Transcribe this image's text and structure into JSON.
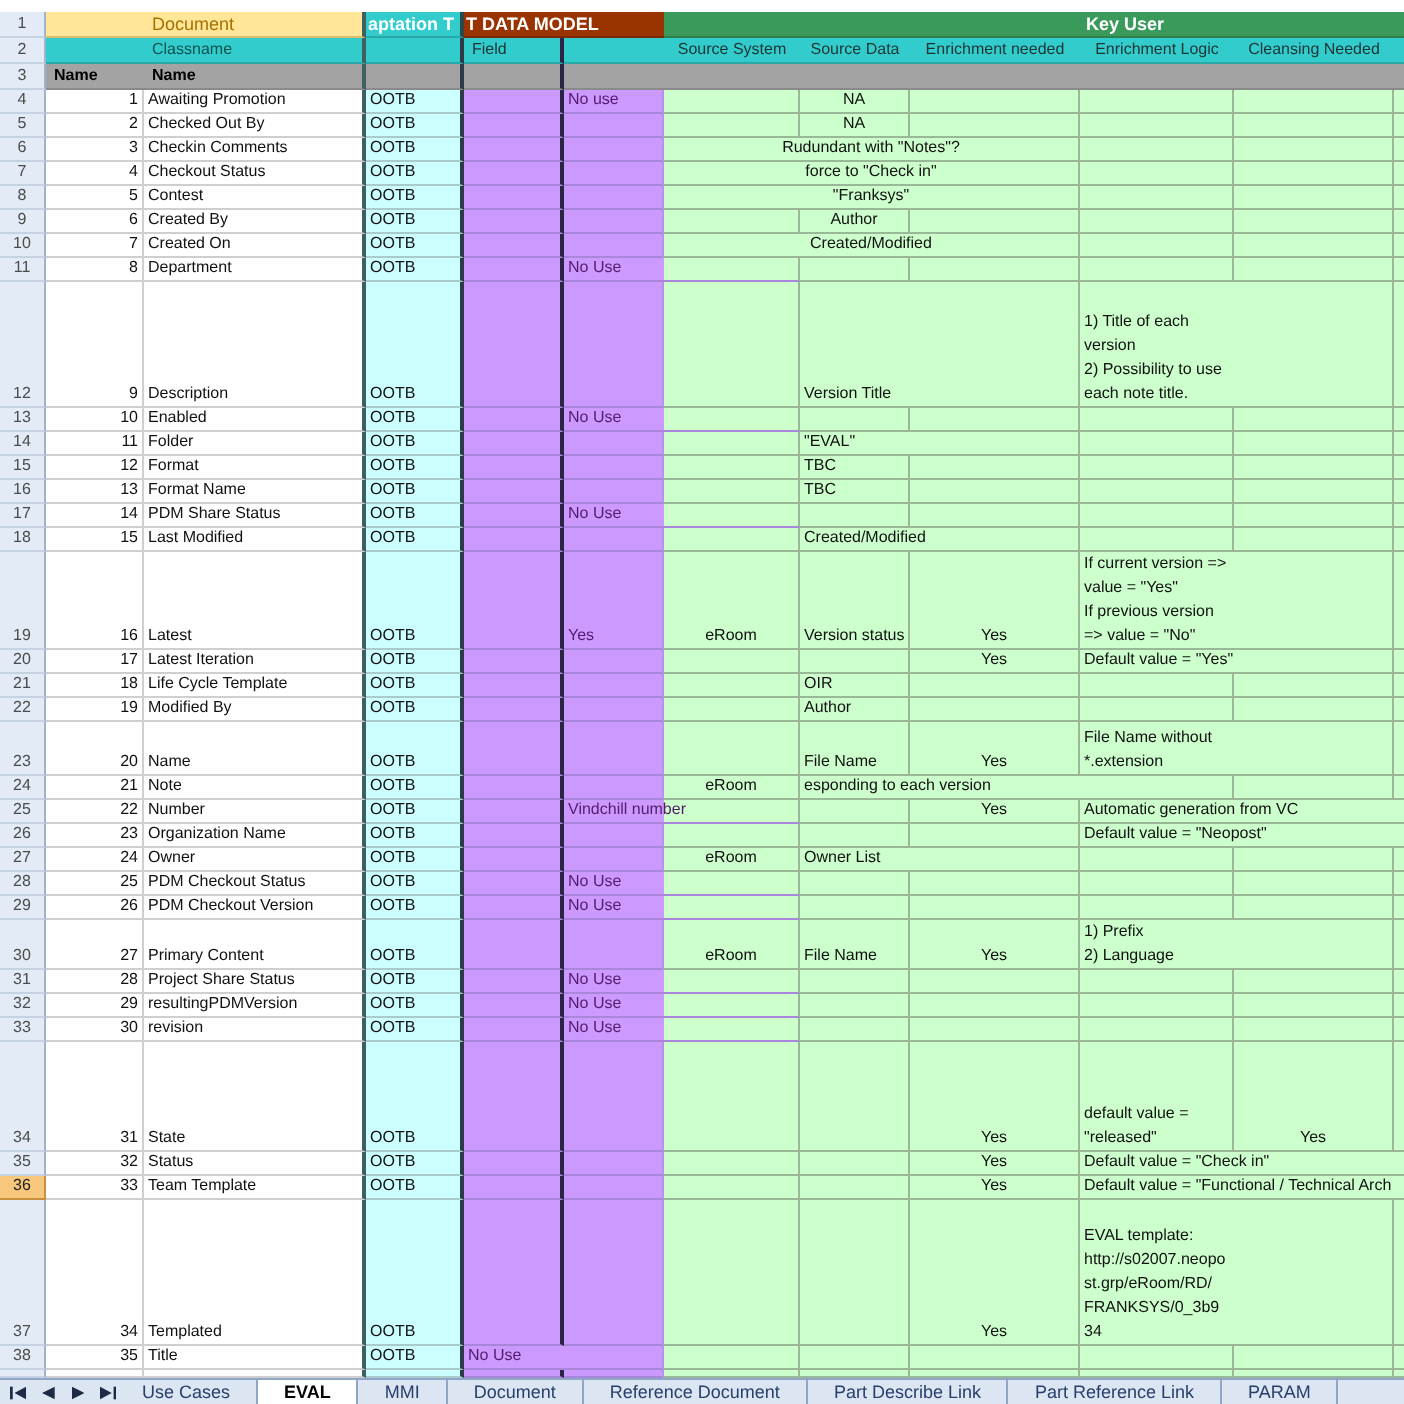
{
  "sheet": {
    "title_row": {
      "row_number": "1",
      "selected": false,
      "document": "Document",
      "column_c": "aptation T",
      "column_d": "T DATA MODEL",
      "key_user": "Key User"
    },
    "header_row": {
      "row_number": "2",
      "selected": false,
      "classname": "Classname",
      "field": "Field",
      "source_system": "Source System",
      "source_data": "Source Data",
      "enrichment_needed": "Enrichment needed",
      "enrichment_logic": "Enrichment Logic",
      "cleansing_needed": "Cleansing Needed"
    },
    "name_row": {
      "row_number": "3",
      "selected": false,
      "column_a": "Name",
      "column_b": "Name"
    },
    "rows": [
      {
        "row_number": "4",
        "selected": false,
        "number": "1",
        "name": "Awaiting Promotion",
        "column_c": "OOTB",
        "column_e": "No use",
        "source_data": "NA"
      },
      {
        "row_number": "5",
        "selected": false,
        "number": "2",
        "name": "Checked Out By",
        "column_c": "OOTB",
        "source_data": "NA"
      },
      {
        "row_number": "6",
        "selected": false,
        "number": "3",
        "name": "Checkin Comments",
        "column_c": "OOTB",
        "source_data": "Rudundant with \"Notes\"?"
      },
      {
        "row_number": "7",
        "selected": false,
        "number": "4",
        "name": "Checkout Status",
        "column_c": "OOTB",
        "source_data": "force to \"Check in\""
      },
      {
        "row_number": "8",
        "selected": false,
        "number": "5",
        "name": "Contest",
        "column_c": "OOTB",
        "source_data": "\"Franksys\""
      },
      {
        "row_number": "9",
        "selected": false,
        "number": "6",
        "name": "Created By",
        "column_c": "OOTB",
        "source_data": "Author"
      },
      {
        "row_number": "10",
        "selected": false,
        "number": "7",
        "name": "Created On",
        "column_c": "OOTB",
        "source_data": "Created/Modified"
      },
      {
        "row_number": "11",
        "selected": false,
        "number": "8",
        "name": "Department",
        "column_c": "OOTB",
        "column_e": "No Use"
      },
      {
        "row_number": "12",
        "selected": false,
        "number": "9",
        "name": "Description",
        "column_c": "OOTB",
        "source_data": "Version Title",
        "enrichment_logic": "1) Title of each\nversion\n2) Possibility to use\neach note title."
      },
      {
        "row_number": "13",
        "selected": false,
        "number": "10",
        "name": "Enabled",
        "column_c": "OOTB",
        "column_e": "No Use"
      },
      {
        "row_number": "14",
        "selected": false,
        "number": "11",
        "name": "Folder",
        "column_c": "OOTB",
        "source_data": "\"EVAL\""
      },
      {
        "row_number": "15",
        "selected": false,
        "number": "12",
        "name": "Format",
        "column_c": "OOTB",
        "source_data": "TBC"
      },
      {
        "row_number": "16",
        "selected": false,
        "number": "13",
        "name": "Format Name",
        "column_c": "OOTB",
        "source_data": "TBC"
      },
      {
        "row_number": "17",
        "selected": false,
        "number": "14",
        "name": "PDM Share Status",
        "column_c": "OOTB",
        "column_e": "No Use"
      },
      {
        "row_number": "18",
        "selected": false,
        "number": "15",
        "name": "Last Modified",
        "column_c": "OOTB",
        "source_data": "Created/Modified"
      },
      {
        "row_number": "19",
        "selected": false,
        "number": "16",
        "name": "Latest",
        "column_c": "OOTB",
        "column_e": "Yes",
        "source_system": "eRoom",
        "source_data": "Version status",
        "enrichment_needed": "Yes",
        "enrichment_logic": "If current version =>\nvalue = \"Yes\"\nIf previous version\n=> value = \"No\""
      },
      {
        "row_number": "20",
        "selected": false,
        "number": "17",
        "name": "Latest Iteration",
        "column_c": "OOTB",
        "enrichment_needed": "Yes",
        "enrichment_logic": "Default value = \"Yes\""
      },
      {
        "row_number": "21",
        "selected": false,
        "number": "18",
        "name": "Life Cycle Template",
        "column_c": "OOTB",
        "source_data": "OIR"
      },
      {
        "row_number": "22",
        "selected": false,
        "number": "19",
        "name": "Modified By",
        "column_c": "OOTB",
        "source_data": "Author"
      },
      {
        "row_number": "23",
        "selected": false,
        "number": "20",
        "name": "Name",
        "column_c": "OOTB",
        "source_data": "File Name",
        "enrichment_needed": "Yes",
        "enrichment_logic": "File Name without\n*.extension"
      },
      {
        "row_number": "24",
        "selected": false,
        "number": "21",
        "name": "Note",
        "column_c": "OOTB",
        "source_system": "eRoom",
        "source_data": "esponding to each version"
      },
      {
        "row_number": "25",
        "selected": false,
        "number": "22",
        "name": "Number",
        "column_c": "OOTB",
        "column_e": "Vindchill number",
        "enrichment_needed": "Yes",
        "enrichment_logic": "Automatic generation from VC"
      },
      {
        "row_number": "26",
        "selected": false,
        "number": "23",
        "name": "Organization Name",
        "column_c": "OOTB",
        "enrichment_logic": "Default value = \"Neopost\""
      },
      {
        "row_number": "27",
        "selected": false,
        "number": "24",
        "name": "Owner",
        "column_c": "OOTB",
        "source_system": "eRoom",
        "source_data": "Owner List"
      },
      {
        "row_number": "28",
        "selected": false,
        "number": "25",
        "name": "PDM Checkout Status",
        "column_c": "OOTB",
        "column_e": "No Use"
      },
      {
        "row_number": "29",
        "selected": false,
        "number": "26",
        "name": "PDM Checkout Version",
        "column_c": "OOTB",
        "column_e": "No Use"
      },
      {
        "row_number": "30",
        "selected": false,
        "number": "27",
        "name": "Primary Content",
        "column_c": "OOTB",
        "source_system": "eRoom",
        "source_data": "File Name",
        "enrichment_needed": "Yes",
        "enrichment_logic": "1) Prefix\n2) Language"
      },
      {
        "row_number": "31",
        "selected": false,
        "number": "28",
        "name": "Project Share Status",
        "column_c": "OOTB",
        "column_e": "No Use"
      },
      {
        "row_number": "32",
        "selected": false,
        "number": "29",
        "name": "resultingPDMVersion",
        "column_c": "OOTB",
        "column_e": "No Use"
      },
      {
        "row_number": "33",
        "selected": false,
        "number": "30",
        "name": "revision",
        "column_c": "OOTB",
        "column_e": "No Use"
      },
      {
        "row_number": "34",
        "selected": false,
        "number": "31",
        "name": "State",
        "column_c": "OOTB",
        "enrichment_needed": "Yes",
        "enrichment_logic": "default value =\n\"released\"",
        "cleansing_needed": "Yes"
      },
      {
        "row_number": "35",
        "selected": false,
        "number": "32",
        "name": "Status",
        "column_c": "OOTB",
        "enrichment_needed": "Yes",
        "enrichment_logic": "Default value = \"Check in\""
      },
      {
        "row_number": "36",
        "selected": true,
        "number": "33",
        "name": "Team Template",
        "column_c": "OOTB",
        "enrichment_needed": "Yes",
        "enrichment_logic": "Default value = \"Functional / Technical Arch"
      },
      {
        "row_number": "37",
        "selected": false,
        "number": "34",
        "name": "Templated",
        "column_c": "OOTB",
        "enrichment_needed": "Yes",
        "enrichment_logic": "EVAL template:\nhttp://s02007.neopo\nst.grp/eRoom/RD/\nFRANKSYS/0_3b9\n34"
      },
      {
        "row_number": "38",
        "selected": false,
        "number": "35",
        "name": "Title",
        "column_c": "OOTB",
        "field": "No Use"
      }
    ]
  },
  "sheet_tabs": [
    {
      "label": "Use Cases",
      "selected": false
    },
    {
      "label": "EVAL",
      "selected": true
    },
    {
      "label": "MMI",
      "selected": false
    },
    {
      "label": "Document",
      "selected": false
    },
    {
      "label": "Reference Document",
      "selected": false
    },
    {
      "label": "Part Describe Link",
      "selected": false
    },
    {
      "label": "Part Reference Link",
      "selected": false
    },
    {
      "label": "PARAM",
      "selected": false
    }
  ]
}
